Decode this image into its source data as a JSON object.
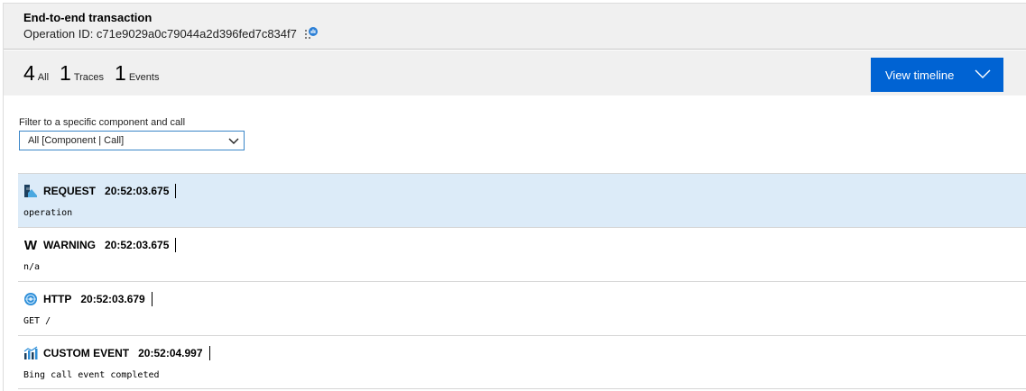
{
  "header": {
    "title": "End-to-end transaction",
    "operation_id": "Operation ID: c71e9029a0c79044a2d396fed7c834f7",
    "copy_icon": "copy-icon"
  },
  "counts": [
    {
      "num": "4",
      "label": "All"
    },
    {
      "num": "1",
      "label": "Traces"
    },
    {
      "num": "1",
      "label": "Events"
    }
  ],
  "timeline_button": {
    "label": "View timeline",
    "icon": "chevron-down-icon",
    "color": "#0063d3"
  },
  "filter": {
    "label": "Filter to a specific component and call",
    "value": "All [Component | Call]"
  },
  "rows": [
    {
      "type": "REQUEST",
      "time": "20:52:03.675",
      "detail": "operation",
      "icon": "request-icon",
      "selected": true
    },
    {
      "type": "WARNING",
      "time": "20:52:03.675",
      "detail": "n/a",
      "icon": "W",
      "selected": false
    },
    {
      "type": "HTTP",
      "time": "20:52:03.679",
      "detail": "GET /",
      "icon": "http-icon",
      "selected": false
    },
    {
      "type": "CUSTOM EVENT",
      "time": "20:52:04.997",
      "detail": "Bing call event completed",
      "icon": "custom-event-icon",
      "selected": false
    }
  ],
  "colors": {
    "accent": "#0063d3",
    "selected_row": "#dcebf8",
    "header_bg": "#f0f0f0"
  }
}
